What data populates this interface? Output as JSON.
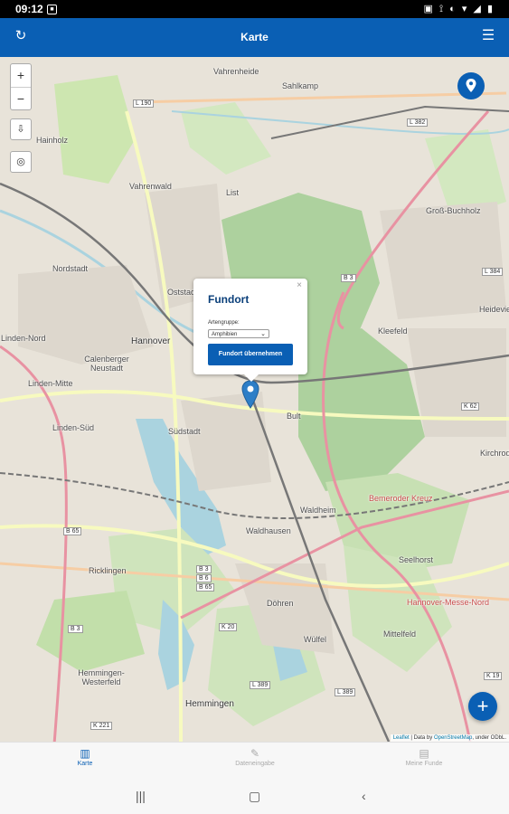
{
  "status_bar": {
    "time": "09:12",
    "left_icon": "notification-icon",
    "right_icons": "▣ ⟟ ◐ ▾ ◢ ▮"
  },
  "app_bar": {
    "title": "Karte",
    "left_icon": "refresh-icon",
    "right_icon": "menu-icon"
  },
  "map": {
    "labels": [
      {
        "text": "Vahrenheide"
      },
      {
        "text": "Sahlkamp"
      },
      {
        "text": "Hainholz"
      },
      {
        "text": "Vahrenwald"
      },
      {
        "text": "List"
      },
      {
        "text": "Groß-Buchholz"
      },
      {
        "text": "Nordstadt"
      },
      {
        "text": "Oststadt"
      },
      {
        "text": "Heideviertel"
      },
      {
        "text": "Linden-Nord"
      },
      {
        "text": "Hannover"
      },
      {
        "text": "Calenberger Neustadt"
      },
      {
        "text": "Kleefeld"
      },
      {
        "text": "Linden-Mitte"
      },
      {
        "text": "Südstadt"
      },
      {
        "text": "Bult"
      },
      {
        "text": "Linden-Süd"
      },
      {
        "text": "Kirchrode"
      },
      {
        "text": "Waldheim"
      },
      {
        "text": "Waldhausen"
      },
      {
        "text": "Ricklingen"
      },
      {
        "text": "Bemeroder Kreuz"
      },
      {
        "text": "Seelhorst"
      },
      {
        "text": "Döhren"
      },
      {
        "text": "Hannover-Messe-Nord"
      },
      {
        "text": "Mittelfeld"
      },
      {
        "text": "Wülfel"
      },
      {
        "text": "Hemmingen-Westerfeld"
      },
      {
        "text": "Hemmingen"
      }
    ],
    "road_badges": [
      "L 190",
      "L 382",
      "B 3",
      "L 384",
      "K 62",
      "B 65",
      "B 3",
      "B 6",
      "B 65",
      "K 20",
      "B 3",
      "L 389",
      "L 389",
      "K 19",
      "K 221"
    ],
    "controls": {
      "zoom_in": "+",
      "zoom_out": "−"
    }
  },
  "popup": {
    "title": "Fundort",
    "close": "×",
    "label": "Artengruppe:",
    "select_value": "Amphibien",
    "button": "Fundort übernehmen"
  },
  "attribution": {
    "leaflet": "Leaflet",
    "text": " | Data by ",
    "osm": "OpenStreetMap",
    "license": ", under ODbL."
  },
  "fab_add": "+",
  "bottom_nav": [
    {
      "label": "Karte",
      "icon": "map-icon",
      "active": true
    },
    {
      "label": "Dateneingabe",
      "icon": "edit-icon",
      "active": false
    },
    {
      "label": "Meine Funde",
      "icon": "list-icon",
      "active": false
    }
  ],
  "colors": {
    "primary": "#0a5fb4",
    "forest": "#add19e",
    "water": "#aad3df",
    "motorway": "#e892a2"
  }
}
